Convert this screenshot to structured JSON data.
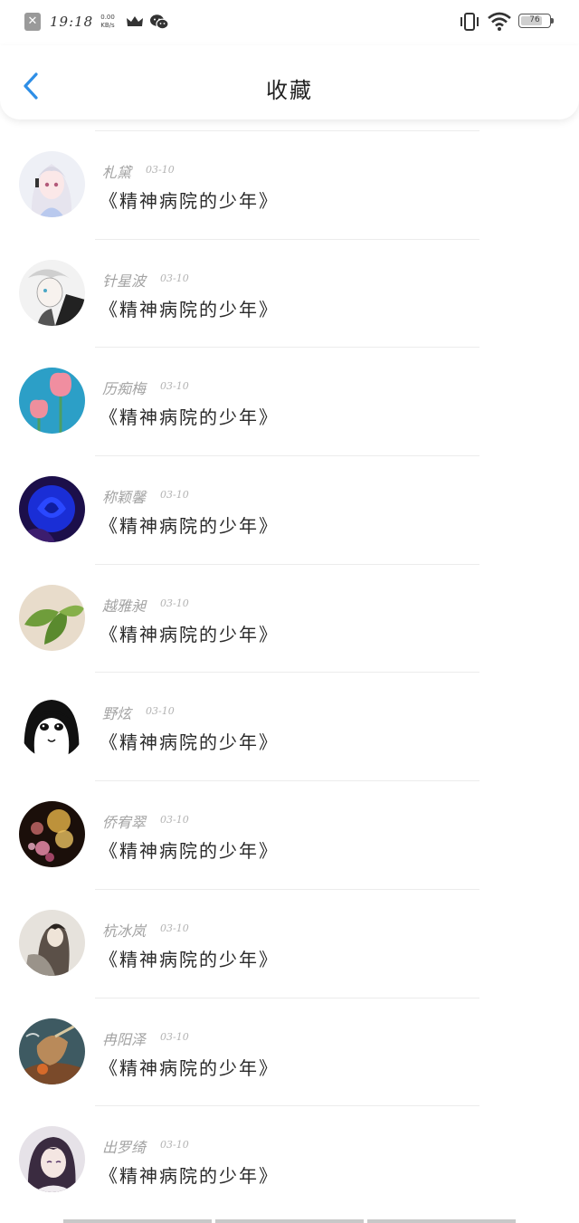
{
  "status_bar": {
    "time": "19:18",
    "net_speed_value": "0.00",
    "net_speed_unit": "KB/s",
    "battery_level": "76"
  },
  "header": {
    "title": "收藏"
  },
  "favorites": [
    {
      "author": "札黛",
      "date": "03-10",
      "title": "《精神病院的少年》",
      "avatar": "anime-girl-white-hair"
    },
    {
      "author": "针星波",
      "date": "03-10",
      "title": "《精神病院的少年》",
      "avatar": "sketch-boy"
    },
    {
      "author": "历痴梅",
      "date": "03-10",
      "title": "《精神病院的少年》",
      "avatar": "pink-tulips"
    },
    {
      "author": "称颖馨",
      "date": "03-10",
      "title": "《精神病院的少年》",
      "avatar": "blue-rose"
    },
    {
      "author": "越雅昶",
      "date": "03-10",
      "title": "《精神病院的少年》",
      "avatar": "green-leaves"
    },
    {
      "author": "野炫",
      "date": "03-10",
      "title": "《精神病院的少年》",
      "avatar": "manga-girl-bw"
    },
    {
      "author": "侨宥翠",
      "date": "03-10",
      "title": "《精神病院的少年》",
      "avatar": "bokeh-lights"
    },
    {
      "author": "杭冰岚",
      "date": "03-10",
      "title": "《精神病院的少年》",
      "avatar": "ink-painting-man"
    },
    {
      "author": "冉阳泽",
      "date": "03-10",
      "title": "《精神病院的少年》",
      "avatar": "warrior-illustration"
    },
    {
      "author": "出罗绮",
      "date": "03-10",
      "title": "《精神病院的少年》",
      "avatar": "anime-boy-purple"
    }
  ],
  "colors": {
    "accent": "#2e8ee6",
    "author_text": "#a3a3a3",
    "title_text": "#2a2a2a",
    "divider": "#ececec"
  }
}
